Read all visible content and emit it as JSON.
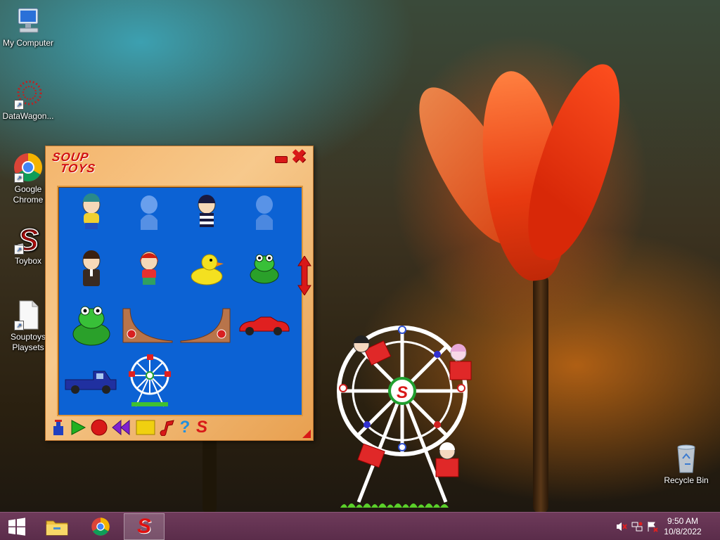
{
  "desktop": {
    "icons": [
      {
        "label": "My Computer",
        "icon": "computer-icon"
      },
      {
        "label": "DataWagon...",
        "icon": "datawagon-icon"
      },
      {
        "label": "Google Chrome",
        "icon": "chrome-icon"
      },
      {
        "label": "Toybox",
        "icon": "soup-s-icon"
      },
      {
        "label": "Souptoys Playsets",
        "icon": "document-icon"
      }
    ],
    "recycle_bin": {
      "label": "Recycle Bin",
      "icon": "recycle-bin-icon"
    }
  },
  "toybox": {
    "logo_line1": "SOUP",
    "logo_line2": "TOYS",
    "toys": [
      {
        "name": "soup-kid-yellow"
      },
      {
        "name": "soup-kid-ghost-1"
      },
      {
        "name": "soup-kid-striped"
      },
      {
        "name": "soup-kid-ghost-2"
      },
      {
        "name": "soup-kid-suit"
      },
      {
        "name": "soup-kid-redhead"
      },
      {
        "name": "rubber-duck"
      },
      {
        "name": "frog-small"
      },
      {
        "name": "frog-large"
      },
      {
        "name": "ramp-left"
      },
      {
        "name": "ramp-right"
      },
      {
        "name": "red-sports-car"
      },
      {
        "name": "blue-pickup-truck"
      },
      {
        "name": "ferris-wheel"
      }
    ],
    "toolbar": [
      {
        "name": "stamp-tool",
        "icon": "stamp-icon"
      },
      {
        "name": "play",
        "icon": "play-icon"
      },
      {
        "name": "record",
        "icon": "record-icon"
      },
      {
        "name": "rewind",
        "icon": "rewind-icon"
      },
      {
        "name": "stop",
        "icon": "stop-icon"
      },
      {
        "name": "music",
        "icon": "music-note-icon"
      },
      {
        "name": "help",
        "icon": "help-icon"
      },
      {
        "name": "soup-menu",
        "icon": "soup-s-icon"
      }
    ],
    "help_glyph": "?",
    "soup_glyph": "S",
    "close_glyph": "✖"
  },
  "ferris_wheel_hub": "S",
  "taskbar": {
    "start_icon": "windows-icon",
    "pinned": [
      {
        "name": "file-explorer",
        "icon": "folder-icon"
      },
      {
        "name": "google-chrome",
        "icon": "chrome-icon"
      },
      {
        "name": "toybox",
        "icon": "soup-s-icon",
        "active": true
      }
    ],
    "clock_time": "9:50 AM",
    "clock_date": "10/8/2022"
  },
  "colors": {
    "taskbar": "#5a2c4a",
    "toy_area": "#0c62d4",
    "soup_red": "#d81818",
    "window_wood": "#f4b56c"
  }
}
